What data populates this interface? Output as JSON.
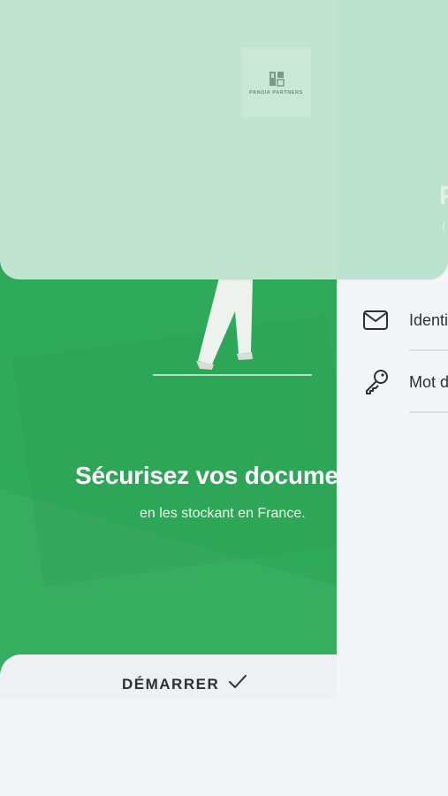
{
  "top_card": {
    "logo": {
      "name": "PANDIA PARTNERS",
      "tagline": "",
      "icon": "company-logo"
    },
    "title_partial": "P",
    "subtitle_partial": "("
  },
  "login": {
    "identifier_placeholder": "Identifiant",
    "password_placeholder": "Mot de passe",
    "identifier_icon": "envelope-icon",
    "password_icon": "key-icon"
  },
  "onboarding": {
    "title": "Sécurisez vos documents",
    "subtitle": "en les stockant en France.",
    "start_label": "DÉMARRER",
    "start_icon": "checkmark-icon"
  },
  "colors": {
    "green_panel": "#2faa5a",
    "top_card": "#c1e4d0",
    "background": "#f3f5f9",
    "text_dark": "#2c2f36"
  }
}
